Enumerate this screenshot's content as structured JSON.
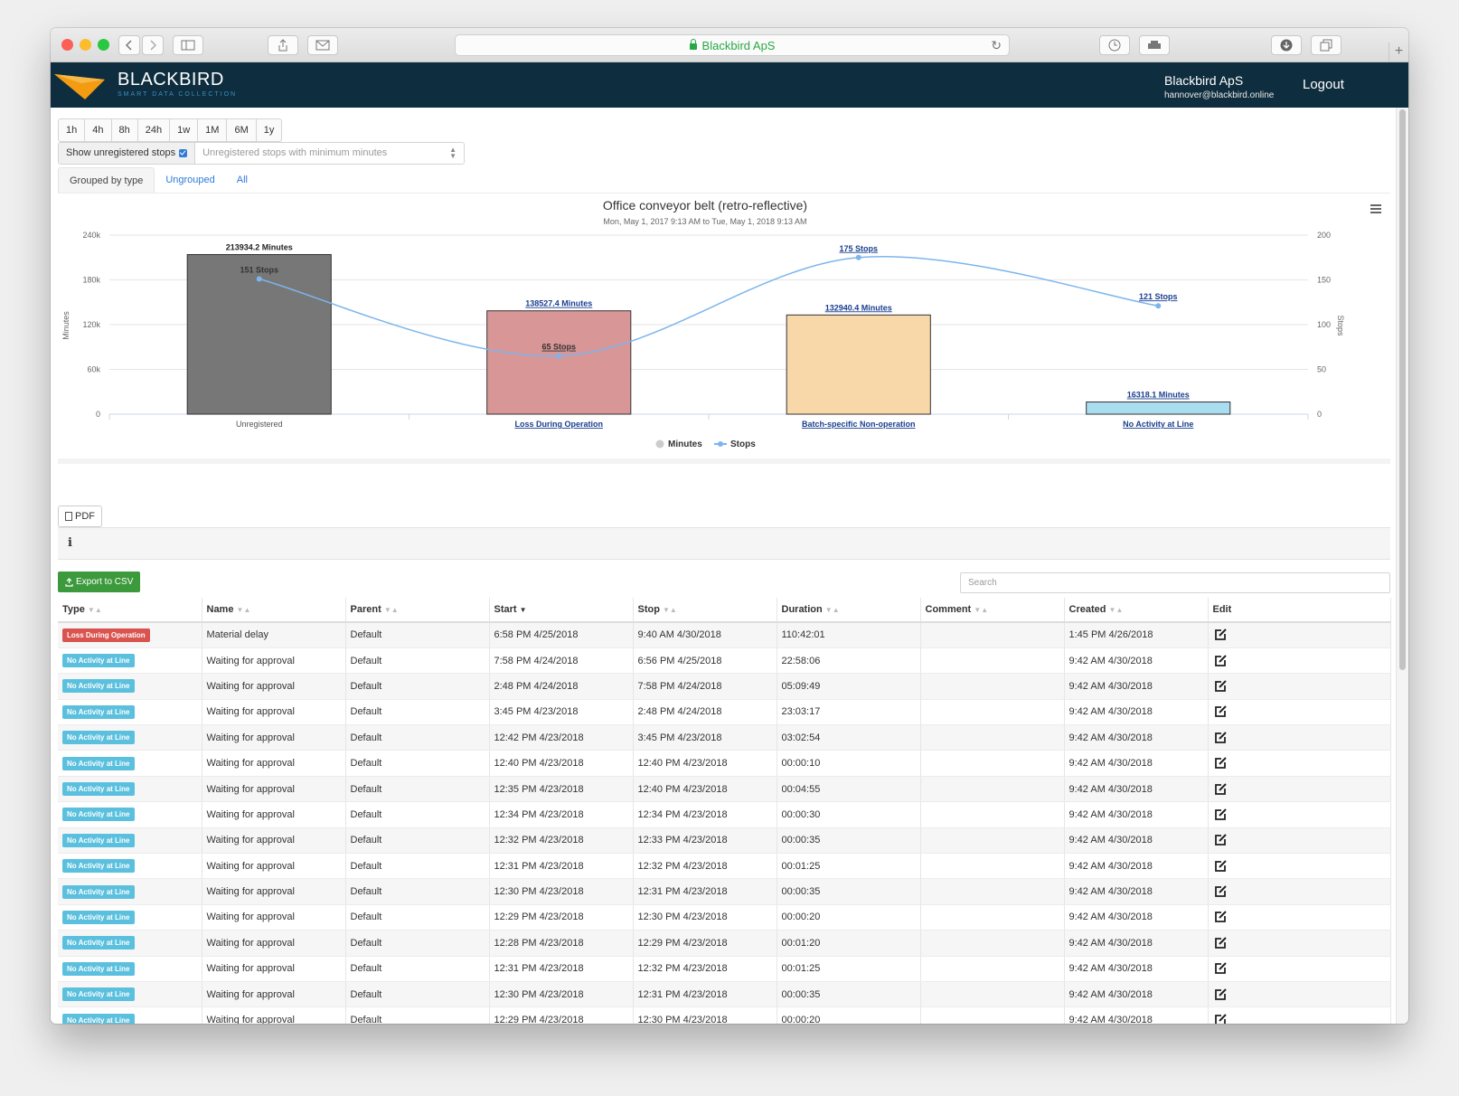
{
  "browser": {
    "url_text": "Blackbird ApS"
  },
  "app": {
    "brand": "BLACKBIRD",
    "tagline": "SMART DATA COLLECTION",
    "account_name": "Blackbird ApS",
    "account_email": "hannover@blackbird.online",
    "logout_label": "Logout"
  },
  "range_buttons": [
    "1h",
    "4h",
    "8h",
    "24h",
    "1w",
    "1M",
    "6M",
    "1y"
  ],
  "filter": {
    "label": "Show unregistered stops",
    "checked": true,
    "placeholder": "Unregistered stops with minimum minutes"
  },
  "tabs": [
    "Grouped by type",
    "Ungrouped",
    "All"
  ],
  "chart_data": {
    "type": "bar",
    "title": "Office conveyor belt (retro-reflective)",
    "subtitle": "Mon, May 1, 2017 9:13 AM to Tue, May 1, 2018 9:13 AM",
    "categories": [
      "Unregistered",
      "Loss During Operation",
      "Batch-specific Non-operation",
      "No Activity at Line"
    ],
    "ylabel": "Minutes",
    "y2label": "Stops",
    "ylim": [
      0,
      240000
    ],
    "y2lim": [
      0,
      200
    ],
    "y_ticks": [
      "0",
      "60k",
      "120k",
      "180k",
      "240k"
    ],
    "y2_ticks": [
      "0",
      "50",
      "100",
      "150",
      "200"
    ],
    "legend": "bottom-center",
    "grid": true,
    "series": [
      {
        "name": "Minutes",
        "type": "bar",
        "values": [
          213934.2,
          138527.4,
          132940.4,
          16318.1
        ],
        "labels": [
          "213934.2 Minutes",
          "138527.4 Minutes",
          "132940.4 Minutes",
          "16318.1 Minutes"
        ],
        "colors": [
          "#777777",
          "#d99696",
          "#f8d7a9",
          "#a9ddf0"
        ]
      },
      {
        "name": "Stops",
        "type": "line",
        "axis": "right",
        "values": [
          151,
          65,
          175,
          121
        ],
        "labels": [
          "151 Stops",
          "65 Stops",
          "175 Stops",
          "121 Stops"
        ],
        "color": "#7cb5ec"
      }
    ]
  },
  "pdf_label": "PDF",
  "export_label": "Export to CSV",
  "search_placeholder": "Search",
  "table": {
    "columns": [
      "Type",
      "Name",
      "Parent",
      "Start",
      "Stop",
      "Duration",
      "Comment",
      "Created",
      "Edit"
    ],
    "rows": [
      {
        "type": "Loss During Operation",
        "badge": "red",
        "name": "Material delay",
        "parent": "Default",
        "start": "6:58 PM 4/25/2018",
        "stop": "9:40 AM 4/30/2018",
        "duration": "110:42:01",
        "comment": "",
        "created": "1:45 PM 4/26/2018"
      },
      {
        "type": "No Activity at Line",
        "badge": "blue",
        "name": "Waiting for approval",
        "parent": "Default",
        "start": "7:58 PM 4/24/2018",
        "stop": "6:56 PM 4/25/2018",
        "duration": "22:58:06",
        "comment": "",
        "created": "9:42 AM 4/30/2018"
      },
      {
        "type": "No Activity at Line",
        "badge": "blue",
        "name": "Waiting for approval",
        "parent": "Default",
        "start": "2:48 PM 4/24/2018",
        "stop": "7:58 PM 4/24/2018",
        "duration": "05:09:49",
        "comment": "",
        "created": "9:42 AM 4/30/2018"
      },
      {
        "type": "No Activity at Line",
        "badge": "blue",
        "name": "Waiting for approval",
        "parent": "Default",
        "start": "3:45 PM 4/23/2018",
        "stop": "2:48 PM 4/24/2018",
        "duration": "23:03:17",
        "comment": "",
        "created": "9:42 AM 4/30/2018"
      },
      {
        "type": "No Activity at Line",
        "badge": "blue",
        "name": "Waiting for approval",
        "parent": "Default",
        "start": "12:42 PM 4/23/2018",
        "stop": "3:45 PM 4/23/2018",
        "duration": "03:02:54",
        "comment": "",
        "created": "9:42 AM 4/30/2018"
      },
      {
        "type": "No Activity at Line",
        "badge": "blue",
        "name": "Waiting for approval",
        "parent": "Default",
        "start": "12:40 PM 4/23/2018",
        "stop": "12:40 PM 4/23/2018",
        "duration": "00:00:10",
        "comment": "",
        "created": "9:42 AM 4/30/2018"
      },
      {
        "type": "No Activity at Line",
        "badge": "blue",
        "name": "Waiting for approval",
        "parent": "Default",
        "start": "12:35 PM 4/23/2018",
        "stop": "12:40 PM 4/23/2018",
        "duration": "00:04:55",
        "comment": "",
        "created": "9:42 AM 4/30/2018"
      },
      {
        "type": "No Activity at Line",
        "badge": "blue",
        "name": "Waiting for approval",
        "parent": "Default",
        "start": "12:34 PM 4/23/2018",
        "stop": "12:34 PM 4/23/2018",
        "duration": "00:00:30",
        "comment": "",
        "created": "9:42 AM 4/30/2018"
      },
      {
        "type": "No Activity at Line",
        "badge": "blue",
        "name": "Waiting for approval",
        "parent": "Default",
        "start": "12:32 PM 4/23/2018",
        "stop": "12:33 PM 4/23/2018",
        "duration": "00:00:35",
        "comment": "",
        "created": "9:42 AM 4/30/2018"
      },
      {
        "type": "No Activity at Line",
        "badge": "blue",
        "name": "Waiting for approval",
        "parent": "Default",
        "start": "12:31 PM 4/23/2018",
        "stop": "12:32 PM 4/23/2018",
        "duration": "00:01:25",
        "comment": "",
        "created": "9:42 AM 4/30/2018"
      },
      {
        "type": "No Activity at Line",
        "badge": "blue",
        "name": "Waiting for approval",
        "parent": "Default",
        "start": "12:30 PM 4/23/2018",
        "stop": "12:31 PM 4/23/2018",
        "duration": "00:00:35",
        "comment": "",
        "created": "9:42 AM 4/30/2018"
      },
      {
        "type": "No Activity at Line",
        "badge": "blue",
        "name": "Waiting for approval",
        "parent": "Default",
        "start": "12:29 PM 4/23/2018",
        "stop": "12:30 PM 4/23/2018",
        "duration": "00:00:20",
        "comment": "",
        "created": "9:42 AM 4/30/2018"
      },
      {
        "type": "No Activity at Line",
        "badge": "blue",
        "name": "Waiting for approval",
        "parent": "Default",
        "start": "12:28 PM 4/23/2018",
        "stop": "12:29 PM 4/23/2018",
        "duration": "00:01:20",
        "comment": "",
        "created": "9:42 AM 4/30/2018"
      },
      {
        "type": "No Activity at Line",
        "badge": "blue",
        "name": "Waiting for approval",
        "parent": "Default",
        "start": "12:31 PM 4/23/2018",
        "stop": "12:32 PM 4/23/2018",
        "duration": "00:01:25",
        "comment": "",
        "created": "9:42 AM 4/30/2018"
      },
      {
        "type": "No Activity at Line",
        "badge": "blue",
        "name": "Waiting for approval",
        "parent": "Default",
        "start": "12:30 PM 4/23/2018",
        "stop": "12:31 PM 4/23/2018",
        "duration": "00:00:35",
        "comment": "",
        "created": "9:42 AM 4/30/2018"
      },
      {
        "type": "No Activity at Line",
        "badge": "blue",
        "name": "Waiting for approval",
        "parent": "Default",
        "start": "12:29 PM 4/23/2018",
        "stop": "12:30 PM 4/23/2018",
        "duration": "00:00:20",
        "comment": "",
        "created": "9:42 AM 4/30/2018"
      }
    ]
  }
}
